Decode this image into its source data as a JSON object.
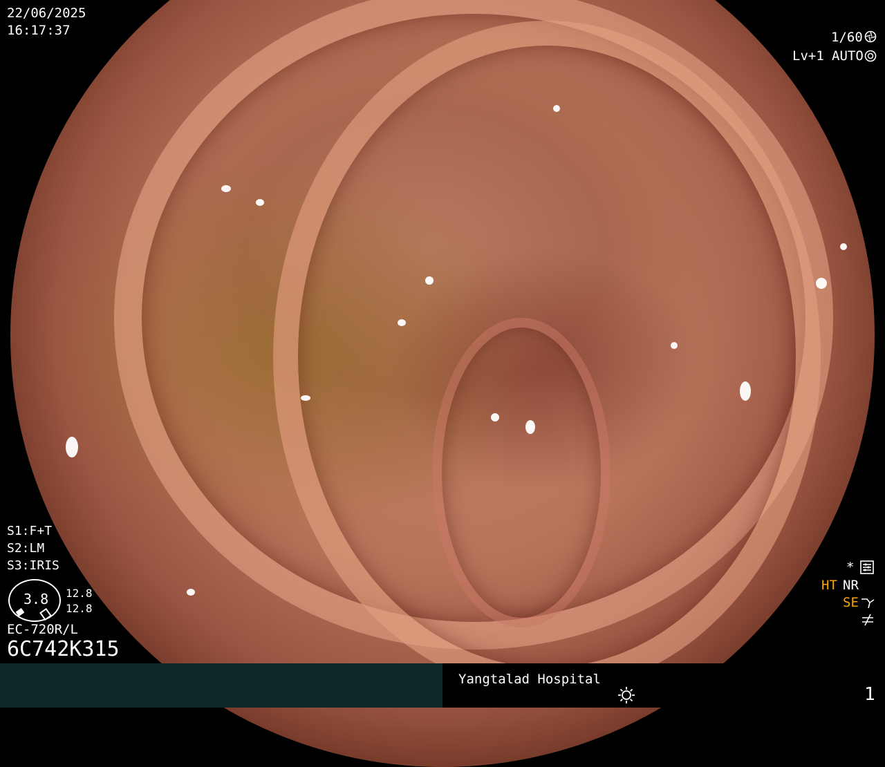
{
  "overlay": {
    "date": "22/06/2025",
    "time": "16:17:37",
    "shutter": "1/60",
    "level": "Lv+1",
    "iris_mode": "AUTO",
    "s1": "F+T",
    "s2": "LM",
    "s3": "IRIS",
    "gauge_value": "3.8",
    "gauge_top": "12.8",
    "gauge_bottom": "12.8",
    "scope_model": "EC-720R/L",
    "serial": "6C742K315",
    "asterisk": "*",
    "ht": "HT",
    "nr": "NR",
    "se": "SE",
    "hospital": "Yangtalad Hospital",
    "image_number": "1"
  },
  "icons": {
    "shutter_icon": "aperture-icon",
    "auto_icon": "iris-icon",
    "settings_icon": "settings-icon",
    "se_icon": "enhance-icon",
    "freeze_icon": "not-equal-icon",
    "light_icon": "sun-icon"
  },
  "colors": {
    "background": "#000000",
    "bottom_bar": "#0e2a28",
    "highlight": "#ffa500",
    "text": "#ffffff"
  }
}
